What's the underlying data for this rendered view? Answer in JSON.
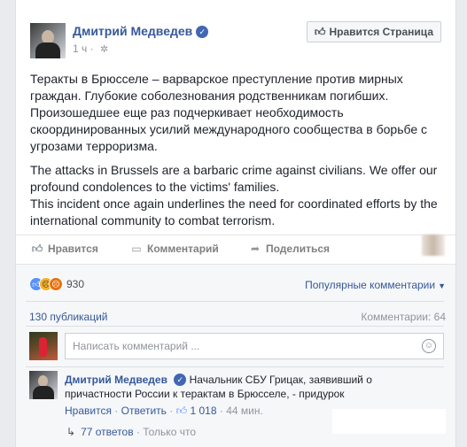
{
  "post": {
    "author": "Дмитрий Медведев",
    "verified_icon": "verified-badge-icon",
    "time": "1 ч",
    "privacy_icon": "gear-icon",
    "like_page_label": "Нравится Страница",
    "text_ru": "Теракты в Брюсселе – варварское преступление против мирных граждан. Глубокие соболезнования родственникам погибших. Произошедшее еще раз подчеркивает необходимость скоординированных усилий международного сообщества в борьбе с угрозами терроризма.",
    "text_en_1": "The attacks in Brussels are a barbaric crime against civilians. We offer our profound condolences to the victims' families.",
    "text_en_2": "This incident once again underlines the need for coordinated efforts by the international community to combat terrorism."
  },
  "actions": {
    "like": "Нравится",
    "comment": "Комментарий",
    "share": "Поделиться"
  },
  "stats": {
    "reactions_count": "930",
    "sort_label": "Популярные комментарии",
    "shares": "130 публикаций",
    "comments": "Комментарии: 64"
  },
  "composer": {
    "placeholder": "Написать комментарий ..."
  },
  "comment": {
    "author": "Дмитрий Медведев",
    "text": "Начальник СБУ Грицак, заявивший о причастности России к терактам в Брюсселе, - придурок",
    "like": "Нравится",
    "reply": "Ответить",
    "likes": "1 018",
    "time": "44 мин.",
    "replies": "77 ответов",
    "replies_time": "Только что"
  },
  "colors": {
    "link": "#365899",
    "meta": "#90949c",
    "like_reaction": "#5890ff"
  }
}
